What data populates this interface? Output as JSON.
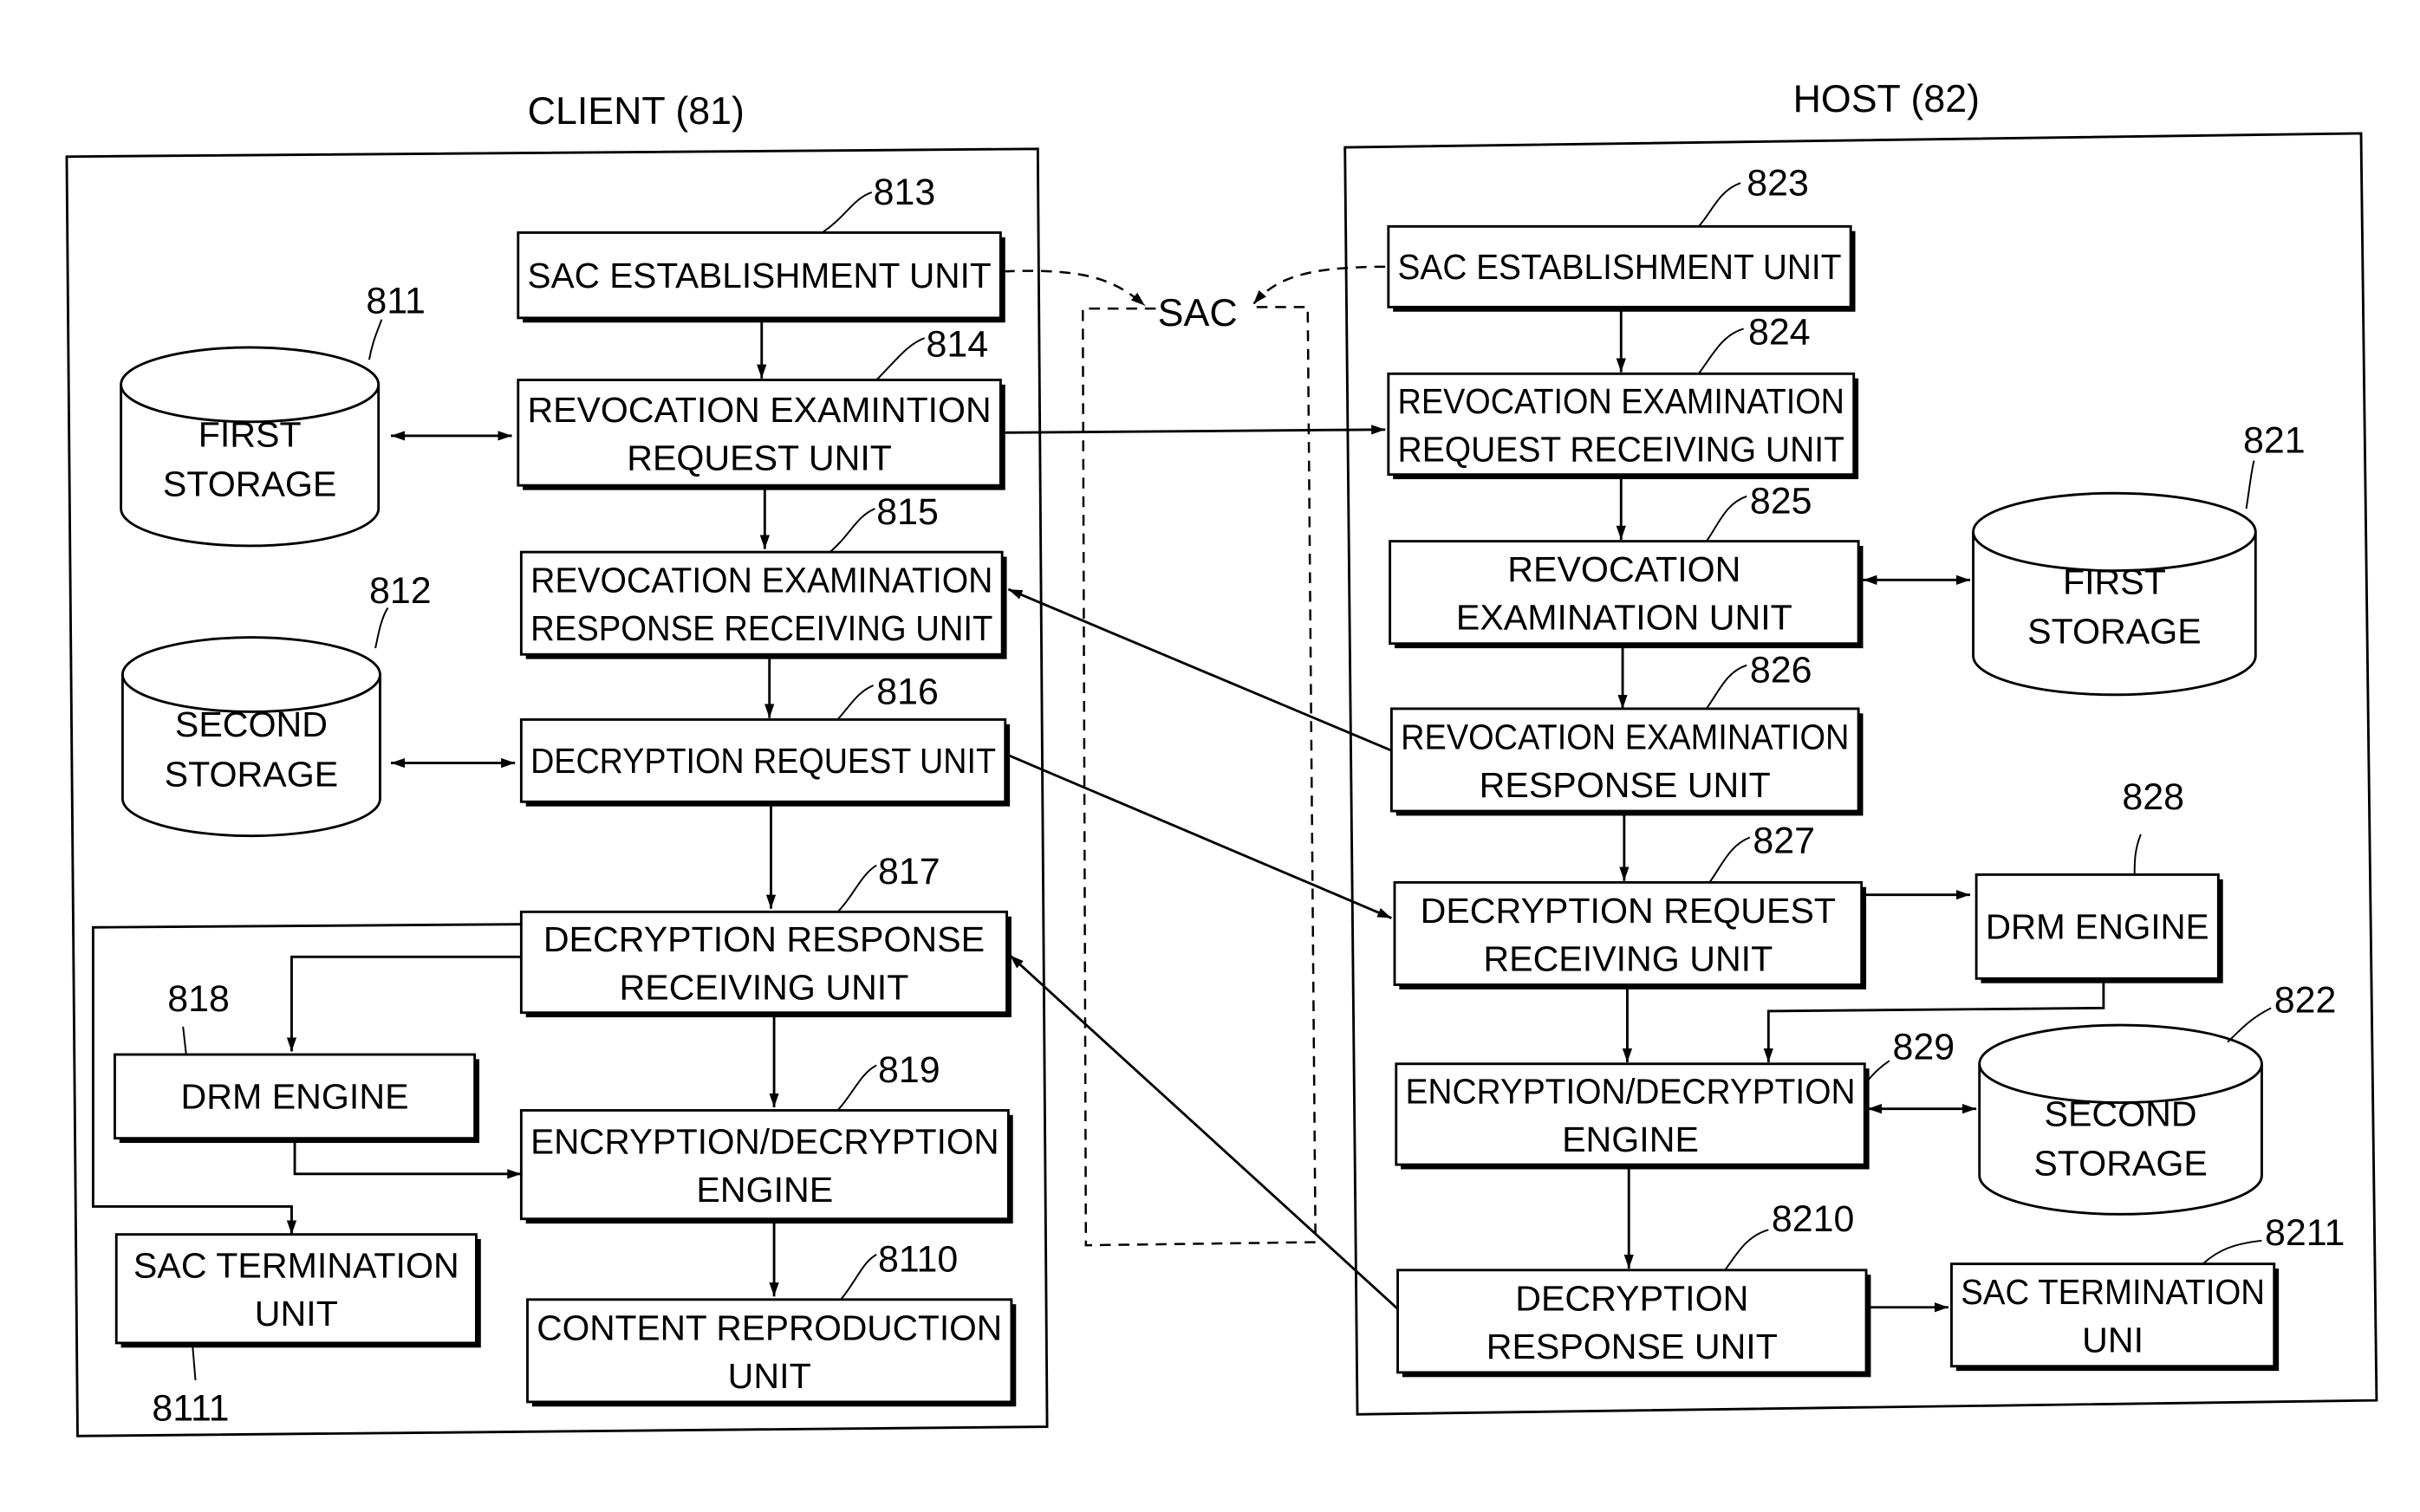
{
  "diagram": {
    "client": {
      "title": "CLIENT  (81)",
      "first_storage": {
        "ref": "811",
        "line1": "FIRST",
        "line2": "STORAGE"
      },
      "second_storage": {
        "ref": "812",
        "line1": "SECOND",
        "line2": "STORAGE"
      },
      "sac_establishment": {
        "ref": "813",
        "line1": "SAC ESTABLISHMENT UNIT"
      },
      "revocation_request": {
        "ref": "814",
        "line1": "REVOCATION EXAMINTION",
        "line2": "REQUEST UNIT"
      },
      "revocation_response_receiving": {
        "ref": "815",
        "line1": "REVOCATION EXAMINATION",
        "line2": "RESPONSE RECEIVING UNIT"
      },
      "decryption_request": {
        "ref": "816",
        "line1": "DECRYPTION REQUEST UNIT"
      },
      "decryption_response_receiving": {
        "ref": "817",
        "line1": "DECRYPTION RESPONSE",
        "line2": "RECEIVING UNIT"
      },
      "drm_engine": {
        "ref": "818",
        "line1": "DRM ENGINE"
      },
      "enc_dec_engine": {
        "ref": "819",
        "line1": "ENCRYPTION/DECRYPTION",
        "line2": "ENGINE"
      },
      "content_reproduction": {
        "ref": "8110",
        "line1": "CONTENT REPRODUCTION",
        "line2": "UNIT"
      },
      "sac_termination": {
        "ref": "8111",
        "line1": "SAC TERMINATION",
        "line2": "UNIT"
      }
    },
    "sac": {
      "label": "SAC"
    },
    "host": {
      "title": "HOST (82)",
      "first_storage": {
        "ref": "821",
        "line1": "FIRST",
        "line2": "STORAGE"
      },
      "second_storage": {
        "ref": "822",
        "line1": "SECOND",
        "line2": "STORAGE"
      },
      "sac_establishment": {
        "ref": "823",
        "line1": "SAC ESTABLISHMENT UNIT"
      },
      "revocation_request_receiving": {
        "ref": "824",
        "line1": "REVOCATION EXAMINATION",
        "line2": "REQUEST RECEIVING UNIT"
      },
      "revocation_examination": {
        "ref": "825",
        "line1": "REVOCATION",
        "line2": "EXAMINATION UNIT"
      },
      "revocation_response": {
        "ref": "826",
        "line1": "REVOCATION EXAMINATION",
        "line2": "RESPONSE UNIT"
      },
      "decryption_request_receiving": {
        "ref": "827",
        "line1": "DECRYPTION REQUEST",
        "line2": "RECEIVING UNIT"
      },
      "drm_engine": {
        "ref": "828",
        "line1": "DRM ENGINE"
      },
      "enc_dec_engine": {
        "ref": "829",
        "line1": "ENCRYPTION/DECRYPTION",
        "line2": "ENGINE"
      },
      "decryption_response": {
        "ref": "8210",
        "line1": "DECRYPTION",
        "line2": "RESPONSE UNIT"
      },
      "sac_termination": {
        "ref": "8211",
        "line1": "SAC TERMINATION",
        "line2": "UNI"
      }
    }
  }
}
